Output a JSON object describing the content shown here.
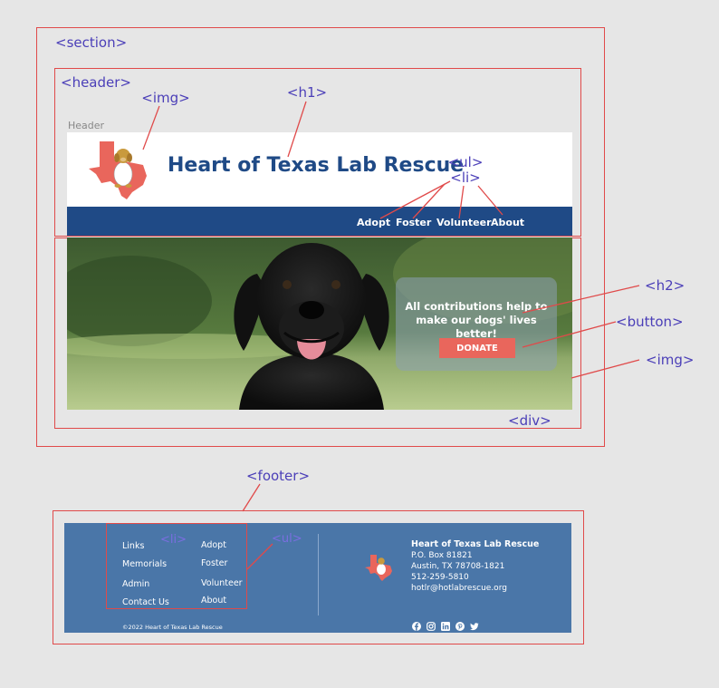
{
  "annotations": {
    "section": "<section>",
    "header": "<header>",
    "img_logo": "<img>",
    "h1": "<h1>",
    "ul_nav": "<ul>",
    "li_nav": "<li>",
    "h2": "<h2>",
    "button": "<button>",
    "img_hero": "<img>",
    "div": "<div>",
    "footer": "<footer>",
    "li_footer": "<li>",
    "ul_footer": "<ul>"
  },
  "site": {
    "header_label": "Header",
    "title": "Heart of Texas Lab Rescue",
    "nav": [
      "Adopt",
      "Foster",
      "Volunteer",
      "About"
    ],
    "hero": {
      "heading_line1": "All contributions help to",
      "heading_line2": "make our dogs' lives better!",
      "donate_label": "DONATE"
    }
  },
  "footer": {
    "links_col1": [
      "Links",
      "Memorials",
      "Admin",
      "Contact Us"
    ],
    "links_col2": [
      "Adopt",
      "Foster",
      "Volunteer",
      "About"
    ],
    "org_name": "Heart of Texas Lab Rescue",
    "address": [
      "P.O. Box 81821",
      "Austin, TX 78708-1821",
      "512-259-5810",
      "hotlr@hotlabrescue.org"
    ],
    "copyright": "©2022 Heart of Texas Lab Rescue",
    "social_icons": [
      "facebook-icon",
      "instagram-icon",
      "linkedin-icon",
      "pinterest-icon",
      "twitter-icon"
    ]
  },
  "colors": {
    "annotation_border": "#e04a4a",
    "annotation_text": "#4b3fb8",
    "brand_blue": "#1f4a86",
    "footer_blue": "#4a76a8",
    "donate_red": "#e9665c"
  }
}
